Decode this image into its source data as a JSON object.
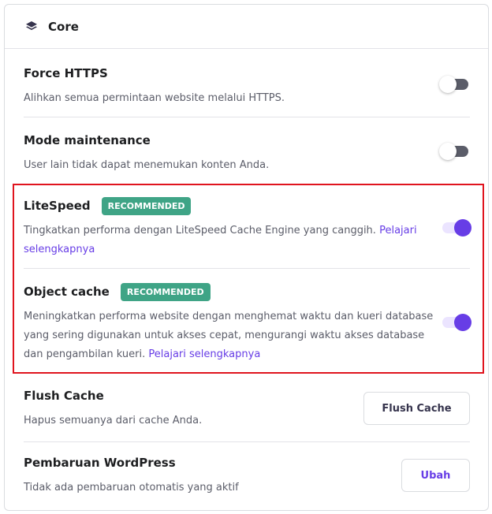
{
  "header": {
    "title": "Core",
    "icon": "layers-icon"
  },
  "settings": [
    {
      "title": "Force HTTPS",
      "description": "Alihkan semua permintaan website melalui HTTPS.",
      "toggle": "off"
    },
    {
      "title": "Mode maintenance",
      "description": "User lain tidak dapat menemukan konten Anda.",
      "toggle": "off"
    },
    {
      "title": "LiteSpeed",
      "badge": "RECOMMENDED",
      "description": "Tingkatkan performa dengan LiteSpeed Cache Engine yang canggih.",
      "link": "Pelajari selengkapnya",
      "toggle": "on"
    },
    {
      "title": "Object cache",
      "badge": "RECOMMENDED",
      "description": "Meningkatkan performa website dengan menghemat waktu dan kueri database yang sering digunakan untuk akses cepat, mengurangi waktu akses database dan pengambilan kueri.",
      "link": "Pelajari selengkapnya",
      "toggle": "on"
    },
    {
      "title": "Flush Cache",
      "description": "Hapus semuanya dari cache Anda.",
      "button": "Flush Cache"
    },
    {
      "title": "Pembaruan WordPress",
      "description": "Tidak ada pembaruan otomatis yang aktif",
      "button": "Ubah"
    }
  ],
  "colors": {
    "accent": "#673de6",
    "badge": "#3fa486",
    "highlight": "#e0141e",
    "text": "#1d1e20",
    "muted": "#5b5d69"
  }
}
